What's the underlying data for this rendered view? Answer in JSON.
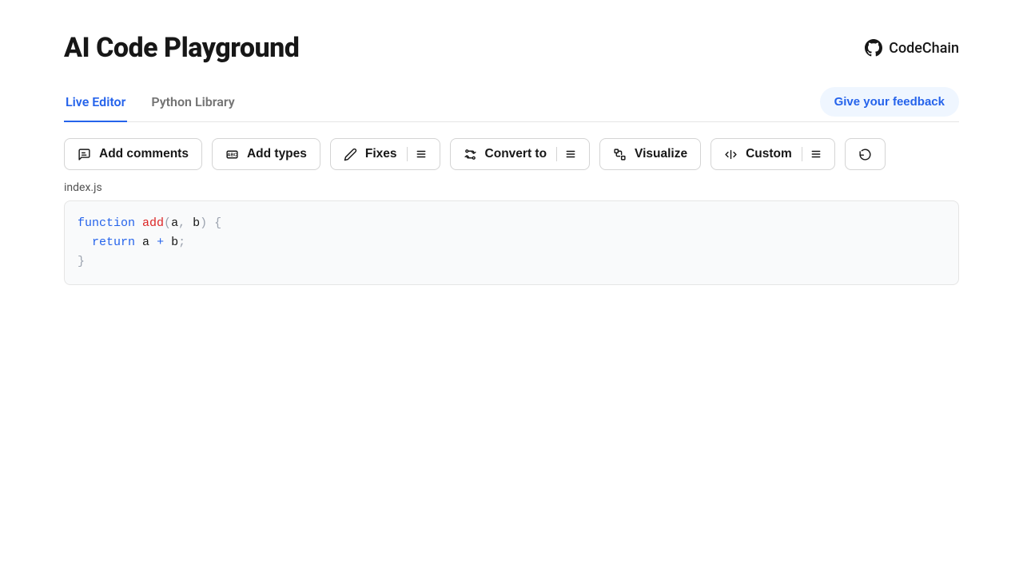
{
  "header": {
    "title": "AI Code Playground",
    "github_label": "CodeChain"
  },
  "tabs": {
    "live_editor": "Live Editor",
    "python_library": "Python Library"
  },
  "feedback_label": "Give your feedback",
  "toolbar": {
    "add_comments": "Add comments",
    "add_types": "Add types",
    "fixes": "Fixes",
    "convert_to": "Convert to",
    "visualize": "Visualize",
    "custom": "Custom"
  },
  "editor": {
    "filename": "index.js",
    "code": {
      "kw_function": "function",
      "fn_name": "add",
      "param_a": "a",
      "param_b": "b",
      "kw_return": "return",
      "var_a": "a",
      "var_b": "b"
    }
  }
}
